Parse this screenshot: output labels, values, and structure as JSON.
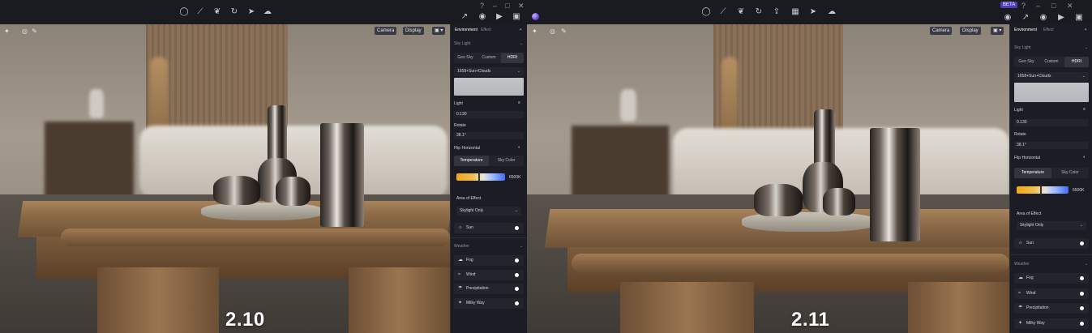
{
  "left": {
    "version": "2.10",
    "viewport": {
      "camera_label": "Camera",
      "display_label": "Display"
    },
    "panel": {
      "tab_environment": "Environment",
      "tab_effect": "Effect",
      "sky_light_title": "Sky Light",
      "sky_modes": [
        "Geo Sky",
        "Custom",
        "HDRI"
      ],
      "sky_mode_selected": "HDRI",
      "hdri_name": "1658+Sun+Clouds",
      "light_label": "Light",
      "light_value": "0.130",
      "rotate_label": "Rotate",
      "rotate_value": "38.1°",
      "flip_label": "Flip Horizontal",
      "temp_tabs": [
        "Temperature",
        "Sky Color"
      ],
      "temp_selected": "Temperature",
      "temp_value": "6500K",
      "temp_fraction": 0.45,
      "area_label": "Area of Effect",
      "area_value": "Skylight Only",
      "sun_label": "Sun",
      "weather_title": "Weather",
      "weather_items": [
        "Fog",
        "Wind",
        "Precipitation",
        "Milky Way"
      ]
    }
  },
  "right": {
    "version": "2.11",
    "beta": "BETA",
    "viewport": {
      "camera_label": "Camera",
      "display_label": "Display"
    },
    "panel": {
      "tab_environment": "Environment",
      "tab_effect": "Effect",
      "sky_light_title": "Sky Light",
      "sky_modes": [
        "Geo Sky",
        "Custom",
        "HDRI"
      ],
      "sky_mode_selected": "HDRI",
      "hdri_name": "1658+Sun+Clouds",
      "light_label": "Light",
      "light_value": "0.130",
      "rotate_label": "Rotate",
      "rotate_value": "38.1°",
      "flip_label": "Flip Horizontal",
      "temp_tabs": [
        "Temperature",
        "Sky Color"
      ],
      "temp_selected": "Temperature",
      "temp_value": "6500K",
      "temp_fraction": 0.45,
      "area_label": "Area of Effect",
      "area_value": "Skylight Only",
      "sun_label": "Sun",
      "weather_title": "Weather",
      "weather_items": [
        "Fog",
        "Wind",
        "Precipitation",
        "Milky Way"
      ]
    }
  },
  "icons": {
    "toolbar": [
      "bulb-icon",
      "line-tool-icon",
      "leaf-icon",
      "cycle-icon",
      "cursor-icon",
      "cloud-icon"
    ],
    "window": [
      "help-icon",
      "minimize-icon",
      "maximize-icon",
      "close-icon"
    ],
    "quick": [
      "camera-icon",
      "export-icon",
      "photo-icon",
      "video-icon",
      "image-icon"
    ]
  }
}
